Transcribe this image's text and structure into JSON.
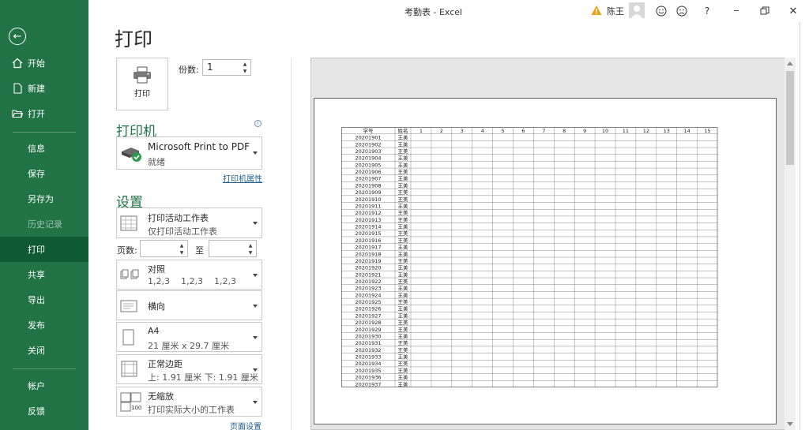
{
  "window": {
    "title": "考勤表  -  Excel",
    "user_name": "陈王",
    "help_label": "?",
    "minimize_label": "─",
    "close_label": "✕"
  },
  "nav": {
    "items": [
      "开始",
      "新建",
      "打开",
      "信息",
      "保存",
      "另存为",
      "历史记录",
      "打印",
      "共享",
      "导出",
      "发布",
      "关闭",
      "帐户",
      "反馈"
    ],
    "active": "打印"
  },
  "heading": "打印",
  "print_button_label": "打印",
  "copies": {
    "label": "份数:",
    "value": "1"
  },
  "printer": {
    "section_title": "打印机",
    "name": "Microsoft Print to PDF",
    "status": "就绪",
    "properties_link": "打印机属性"
  },
  "settings": {
    "section_title": "设置",
    "scope": {
      "title": "打印活动工作表",
      "desc": "仅打印活动工作表"
    },
    "pages_label": "页数:",
    "pages_to_label": "至",
    "collate": {
      "title": "对照",
      "desc": "1,2,3    1,2,3    1,2,3"
    },
    "orientation": {
      "title": "横向"
    },
    "paper": {
      "title": "A4",
      "desc": "21 厘米 x 29.7 厘米"
    },
    "margins": {
      "title": "正常边距",
      "desc": "上: 1.91 厘米 下: 1.91 厘米"
    },
    "scaling": {
      "title": "无缩放",
      "desc": "打印实际大小的工作表",
      "icon_text": "100"
    },
    "page_setup_link": "页面设置"
  },
  "preview": {
    "headers": [
      "学号",
      "姓名",
      "1",
      "2",
      "3",
      "4",
      "5",
      "6",
      "7",
      "8",
      "9",
      "10",
      "11",
      "12",
      "13",
      "14",
      "15"
    ],
    "student_name": "王美",
    "ids": [
      "20201901",
      "20201902",
      "20201903",
      "20201904",
      "20201905",
      "20201906",
      "20201907",
      "20201908",
      "20201909",
      "20201910",
      "20201911",
      "20201912",
      "20201913",
      "20201914",
      "20201915",
      "20201916",
      "20201917",
      "20201918",
      "20201919",
      "20201920",
      "20201921",
      "20201922",
      "20201923",
      "20201924",
      "20201925",
      "20201926",
      "20201927",
      "20201928",
      "20201929",
      "20201930",
      "20201931",
      "20201932",
      "20201933",
      "20201934",
      "20201935",
      "20201936",
      "20201937"
    ]
  },
  "colors": {
    "accent": "#217346",
    "sidebar_active": "#0f5a32",
    "warning": "#e8a317"
  }
}
